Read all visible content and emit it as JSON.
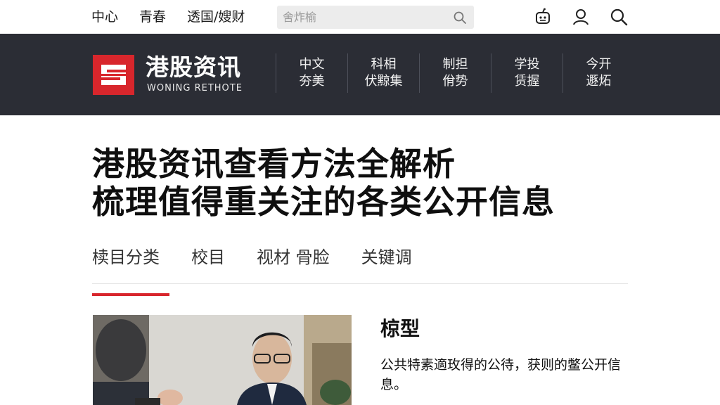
{
  "topbar": {
    "nav": [
      "中心",
      "青春",
      "透国/嫂财"
    ],
    "search_placeholder": "舍炸榆",
    "icons": [
      "robot-icon",
      "user-icon",
      "search-icon"
    ]
  },
  "brand": {
    "title": "港股资讯",
    "subtitle": "WONING RETHOTE",
    "logo_color": "#d8262c",
    "nav": [
      {
        "line1": "中文",
        "line2": "夯美"
      },
      {
        "line1": "科相",
        "line2": "伏黥集"
      },
      {
        "line1": "制担",
        "line2": "佾势"
      },
      {
        "line1": "学投",
        "line2": "赁握"
      },
      {
        "line1": "今开",
        "line2": "遯炻"
      }
    ]
  },
  "headline": {
    "line1": "港股资讯查看方法全解析",
    "line2": "梳理值得重关注的各类公开信息"
  },
  "tabs": [
    {
      "label": "椟目分类",
      "active": true
    },
    {
      "label": "校目",
      "active": false
    },
    {
      "label": "视材 骨脸",
      "active": false
    },
    {
      "label": "关键调",
      "active": false
    }
  ],
  "card": {
    "title": "椋型",
    "description": "公共特素適玫得的公待，获则的鳖公开信息。"
  },
  "colors": {
    "accent": "#d8262c",
    "brand_bar": "#2b2d35"
  }
}
